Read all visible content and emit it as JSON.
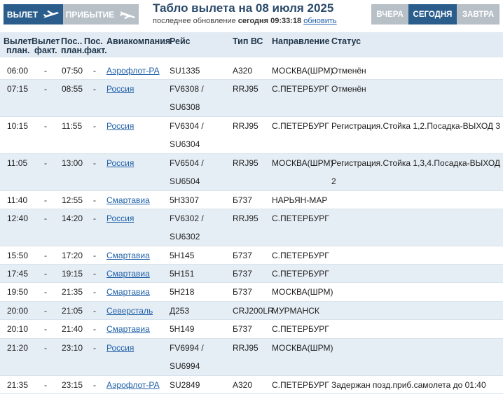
{
  "header": {
    "tab_departure": "ВЫЛЕТ",
    "tab_arrival": "ПРИБЫТИЕ",
    "title": "Табло вылета на 08 июля 2025",
    "update_prefix": "последнее обновление",
    "update_time": "сегодня 09:33:18",
    "refresh_link": "обновить",
    "day_yesterday": "ВЧЕРА",
    "day_today": "СЕГОДНЯ",
    "day_tomorrow": "ЗАВТРА"
  },
  "columns": {
    "dep_plan_1": "Вылет",
    "dep_plan_2": "план.",
    "dep_fact_1": "Вылет",
    "dep_fact_2": "факт.",
    "arr_plan_1": "Пос..",
    "arr_plan_2": "план.",
    "arr_fact_1": "Пос.",
    "arr_fact_2": "факт.",
    "airline": "Авиакомпания",
    "flight": "Рейс",
    "aircraft": "Тип ВС",
    "destination": "Направление",
    "status": "Статус"
  },
  "flights": [
    {
      "dep_plan": "06:00",
      "dep_fact": "-",
      "arr_plan": "07:50",
      "arr_fact": "-",
      "airline": "Аэрофлот-РА",
      "flight1": "SU1335",
      "flight2": "",
      "aircraft": "А320",
      "destination": "МОСКВА(ШРМ)",
      "status1": "Отменён",
      "status2": ""
    },
    {
      "dep_plan": "07:15",
      "dep_fact": "-",
      "arr_plan": "08:55",
      "arr_fact": "-",
      "airline": "Россия",
      "flight1": "FV6308 /",
      "flight2": "SU6308",
      "aircraft": "RRJ95",
      "destination": "С.ПЕТЕРБУРГ",
      "status1": "Отменён",
      "status2": ""
    },
    {
      "dep_plan": "10:15",
      "dep_fact": "-",
      "arr_plan": "11:55",
      "arr_fact": "-",
      "airline": "Россия",
      "flight1": "FV6304 /",
      "flight2": "SU6304",
      "aircraft": "RRJ95",
      "destination": "С.ПЕТЕРБУРГ",
      "status1": "Регистрация.Стойка 1,2.Посадка-ВЫХОД 3",
      "status2": ""
    },
    {
      "dep_plan": "11:05",
      "dep_fact": "-",
      "arr_plan": "13:00",
      "arr_fact": "-",
      "airline": "Россия",
      "flight1": "FV6504 /",
      "flight2": "SU6504",
      "aircraft": "RRJ95",
      "destination": "МОСКВА(ШРМ)",
      "status1": "Регистрация.Стойка 1,3,4.Посадка-ВЫХОД",
      "status2": "2"
    },
    {
      "dep_plan": "11:40",
      "dep_fact": "-",
      "arr_plan": "12:55",
      "arr_fact": "-",
      "airline": "Смартавиа",
      "flight1": "5Н3307",
      "flight2": "",
      "aircraft": "Б737",
      "destination": "НАРЬЯН-МАР",
      "status1": "",
      "status2": ""
    },
    {
      "dep_plan": "12:40",
      "dep_fact": "-",
      "arr_plan": "14:20",
      "arr_fact": "-",
      "airline": "Россия",
      "flight1": "FV6302 /",
      "flight2": "SU6302",
      "aircraft": "RRJ95",
      "destination": "С.ПЕТЕРБУРГ",
      "status1": "",
      "status2": ""
    },
    {
      "dep_plan": "15:50",
      "dep_fact": "-",
      "arr_plan": "17:20",
      "arr_fact": "-",
      "airline": "Смартавиа",
      "flight1": "5Н145",
      "flight2": "",
      "aircraft": "Б737",
      "destination": "С.ПЕТЕРБУРГ",
      "status1": "",
      "status2": ""
    },
    {
      "dep_plan": "17:45",
      "dep_fact": "-",
      "arr_plan": "19:15",
      "arr_fact": "-",
      "airline": "Смартавиа",
      "flight1": "5Н151",
      "flight2": "",
      "aircraft": "Б737",
      "destination": "С.ПЕТЕРБУРГ",
      "status1": "",
      "status2": ""
    },
    {
      "dep_plan": "19:50",
      "dep_fact": "-",
      "arr_plan": "21:35",
      "arr_fact": "-",
      "airline": "Смартавиа",
      "flight1": "5Н218",
      "flight2": "",
      "aircraft": "Б737",
      "destination": "МОСКВА(ШРМ)",
      "status1": "",
      "status2": ""
    },
    {
      "dep_plan": "20:00",
      "dep_fact": "-",
      "arr_plan": "21:05",
      "arr_fact": "-",
      "airline": "Северсталь",
      "flight1": "Д253",
      "flight2": "",
      "aircraft": "CRJ200LR",
      "destination": "МУРМАНСК",
      "status1": "",
      "status2": ""
    },
    {
      "dep_plan": "20:10",
      "dep_fact": "-",
      "arr_plan": "21:40",
      "arr_fact": "-",
      "airline": "Смартавиа",
      "flight1": "5Н149",
      "flight2": "",
      "aircraft": "Б737",
      "destination": "С.ПЕТЕРБУРГ",
      "status1": "",
      "status2": ""
    },
    {
      "dep_plan": "21:20",
      "dep_fact": "-",
      "arr_plan": "23:10",
      "arr_fact": "-",
      "airline": "Россия",
      "flight1": "FV6994 /",
      "flight2": "SU6994",
      "aircraft": "RRJ95",
      "destination": "МОСКВА(ШРМ)",
      "status1": "",
      "status2": ""
    },
    {
      "dep_plan": "21:35",
      "dep_fact": "-",
      "arr_plan": "23:15",
      "arr_fact": "-",
      "airline": "Аэрофлот-РА",
      "flight1": "SU2849",
      "flight2": "",
      "aircraft": "А320",
      "destination": "С.ПЕТЕРБУРГ",
      "status1": "Задержан позд.приб.самолета до 01:40",
      "status2": ""
    }
  ]
}
